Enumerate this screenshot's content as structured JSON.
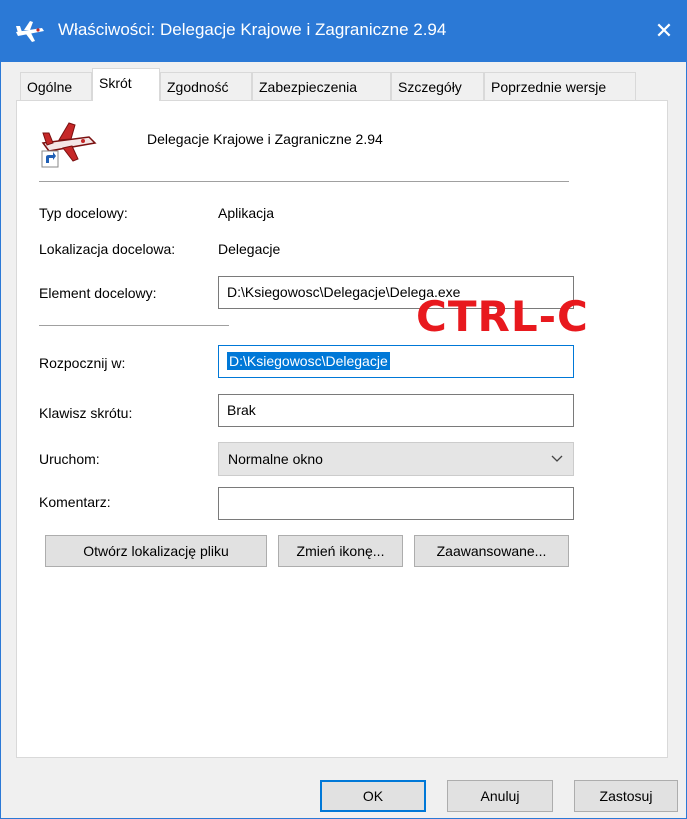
{
  "window": {
    "title": "Właściwości: Delegacje Krajowe i Zagraniczne 2.94",
    "icon": "airplane-icon",
    "close_glyph": "✕"
  },
  "tabs": [
    {
      "label": "Ogólne",
      "active": false
    },
    {
      "label": "Skrót",
      "active": true
    },
    {
      "label": "Zgodność",
      "active": false
    },
    {
      "label": "Zabezpieczenia",
      "active": false
    },
    {
      "label": "Szczegóły",
      "active": false
    },
    {
      "label": "Poprzednie wersje",
      "active": false
    }
  ],
  "shortcut": {
    "name": "Delegacje Krajowe i Zagraniczne 2.94",
    "target_type_label": "Typ docelowy:",
    "target_type_value": "Aplikacja",
    "target_location_label": "Lokalizacja docelowa:",
    "target_location_value": "Delegacje",
    "target_label": "Element docelowy:",
    "target_value": "D:\\Ksiegowosc\\Delegacje\\Delega.exe",
    "start_in_label": "Rozpocznij w:",
    "start_in_value": "D:\\Ksiegowosc\\Delegacje",
    "hotkey_label": "Klawisz skrótu:",
    "hotkey_value": "Brak",
    "run_label": "Uruchom:",
    "run_value": "Normalne okno",
    "comment_label": "Komentarz:",
    "comment_value": ""
  },
  "buttons": {
    "open_location": "Otwórz lokalizację pliku",
    "change_icon": "Zmień ikonę...",
    "advanced": "Zaawansowane..."
  },
  "footer": {
    "ok": "OK",
    "cancel": "Anuluj",
    "apply": "Zastosuj"
  },
  "annotation": {
    "text": "CTRL-C",
    "color": "#e8191e"
  },
  "colors": {
    "titlebar": "#2b79d6",
    "selection": "#0078d7"
  }
}
